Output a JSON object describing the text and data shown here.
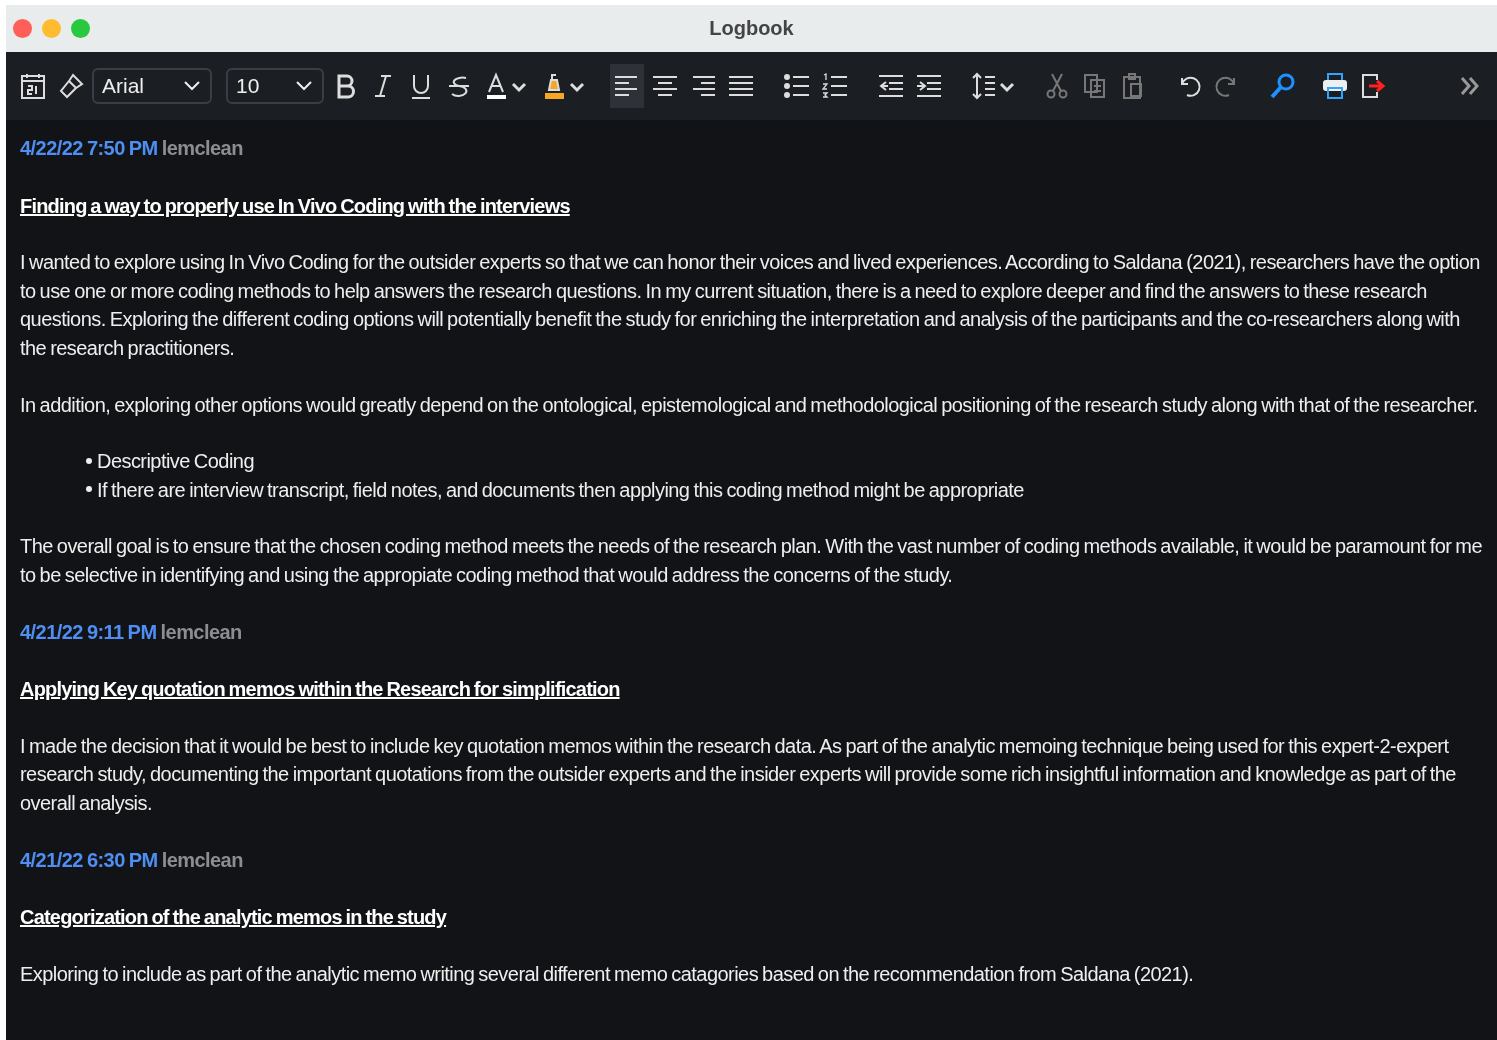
{
  "window": {
    "title": "Logbook"
  },
  "toolbar": {
    "font": {
      "value": "Arial"
    },
    "size": {
      "value": "10"
    },
    "alignment": [
      {
        "selected": true
      },
      {
        "selected": false
      },
      {
        "selected": false
      },
      {
        "selected": false
      }
    ],
    "clipboard": [
      {
        "disabled": true
      },
      {
        "disabled": true
      },
      {
        "disabled": true
      }
    ],
    "history": [
      {
        "disabled": false
      },
      {
        "disabled": true
      }
    ]
  },
  "entries": [
    {
      "date": "4/22/22 7:50 PM",
      "author": "lemclean",
      "title": "Finding a way to properly use In Vivo Coding with the interviews",
      "blocks": [
        {
          "kind": "paragraph",
          "text": "I wanted to explore using In Vivo Coding for the outsider experts so that we can honor their voices and lived experiences. According to Saldana (2021), researchers have the option to use one or more coding methods to help answers the research questions. In my current situation, there is a need to explore deeper and find the answers to these research questions. Exploring the different coding options will potentially benefit the study for enriching the interpretation and analysis of the participants and the co-researchers along with the research practitioners."
        },
        {
          "kind": "paragraph",
          "text": "In addition, exploring other options would greatly depend on the ontological, epistemological and methodological positioning of the research study along with that of the researcher."
        },
        {
          "kind": "bullets",
          "items": [
            "Descriptive Coding",
            "If there are interview transcript, field notes, and documents then applying this coding method might be appropriate"
          ]
        },
        {
          "kind": "paragraph",
          "text": "The overall goal is to ensure that the chosen coding method meets the needs of the research plan. With the vast number of coding methods available, it would be paramount for me to be selective in identifying and using the appropiate coding method that would address the concerns of the study."
        }
      ]
    },
    {
      "date": "4/21/22 9:11 PM",
      "author": "lemclean",
      "title": "Applying Key quotation memos within the Research for simplification",
      "blocks": [
        {
          "kind": "paragraph",
          "text": "I made the decision that it would be best to include key quotation memos within the research data. As part of the analytic memoing technique being used for this expert-2-expert research study, documenting the important quotations from the outsider experts and the insider experts will provide some rich insightful information and knowledge as part of the overall analysis."
        }
      ]
    },
    {
      "date": "4/21/22 6:30 PM",
      "author": "lemclean",
      "title": "Categorization of the analytic memos in the study",
      "blocks": [
        {
          "kind": "paragraph",
          "text": "Exploring to include as part of the analytic memo writing several different memo catagories based on the recommendation from Saldana (2021)."
        }
      ]
    }
  ]
}
